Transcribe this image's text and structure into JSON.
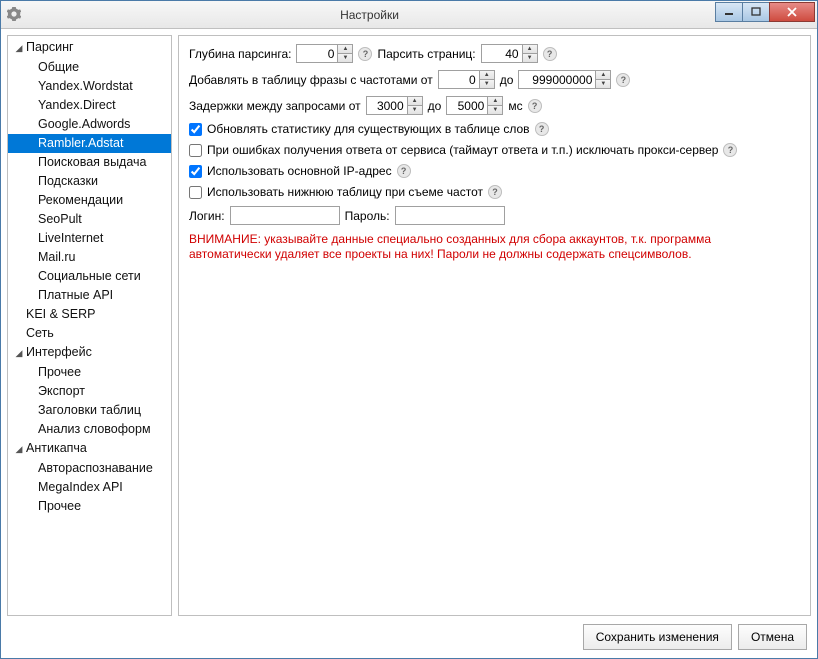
{
  "window": {
    "title": "Настройки"
  },
  "sidebar": {
    "groups": [
      {
        "label": "Парсинг",
        "expanded": true,
        "items": [
          {
            "label": "Общие",
            "selected": false
          },
          {
            "label": "Yandex.Wordstat",
            "selected": false
          },
          {
            "label": "Yandex.Direct",
            "selected": false
          },
          {
            "label": "Google.Adwords",
            "selected": false
          },
          {
            "label": "Rambler.Adstat",
            "selected": true
          },
          {
            "label": "Поисковая выдача",
            "selected": false
          },
          {
            "label": "Подсказки",
            "selected": false
          },
          {
            "label": "Рекомендации",
            "selected": false
          },
          {
            "label": "SeoPult",
            "selected": false
          },
          {
            "label": "LiveInternet",
            "selected": false
          },
          {
            "label": "Mail.ru",
            "selected": false
          },
          {
            "label": "Социальные сети",
            "selected": false
          },
          {
            "label": "Платные API",
            "selected": false
          }
        ]
      },
      {
        "label": "KEI & SERP",
        "expanded": false,
        "items": []
      },
      {
        "label": "Сеть",
        "expanded": false,
        "items": []
      },
      {
        "label": "Интерфейс",
        "expanded": true,
        "items": [
          {
            "label": "Прочее",
            "selected": false
          },
          {
            "label": "Экспорт",
            "selected": false
          },
          {
            "label": "Заголовки таблиц",
            "selected": false
          },
          {
            "label": "Анализ словоформ",
            "selected": false
          }
        ]
      },
      {
        "label": "Антикапча",
        "expanded": true,
        "items": [
          {
            "label": "Автораспознавание",
            "selected": false
          },
          {
            "label": "MegaIndex API",
            "selected": false
          },
          {
            "label": "Прочее",
            "selected": false
          }
        ]
      }
    ]
  },
  "form": {
    "depth_label": "Глубина парсинга:",
    "depth_value": "0",
    "pages_label": "Парсить страниц:",
    "pages_value": "40",
    "addfreq_label": "Добавлять в таблицу фразы с частотами от",
    "addfreq_from": "0",
    "to_label": "до",
    "addfreq_to": "999000000",
    "delay_label": "Задержки между запросами от",
    "delay_from": "3000",
    "delay_to": "5000",
    "ms_label": "мс",
    "cb_update_stats": {
      "label": "Обновлять статистику для существующих в таблице слов",
      "checked": true
    },
    "cb_exclude_proxy": {
      "label": "При ошибках получения ответа от сервиса (таймаут ответа и т.п.) исключать прокси-сервер",
      "checked": false
    },
    "cb_use_main_ip": {
      "label": "Использовать основной IP-адрес",
      "checked": true
    },
    "cb_use_bottom_table": {
      "label": "Использовать нижнюю таблицу при съеме частот",
      "checked": false
    },
    "login_label": "Логин:",
    "login_value": "",
    "password_label": "Пароль:",
    "password_value": "",
    "warning": "ВНИМАНИЕ: указывайте данные специально созданных для сбора аккаунтов, т.к. программа автоматически удаляет все проекты на них! Пароли не должны содержать спецсимволов."
  },
  "footer": {
    "save": "Сохранить изменения",
    "cancel": "Отмена"
  }
}
